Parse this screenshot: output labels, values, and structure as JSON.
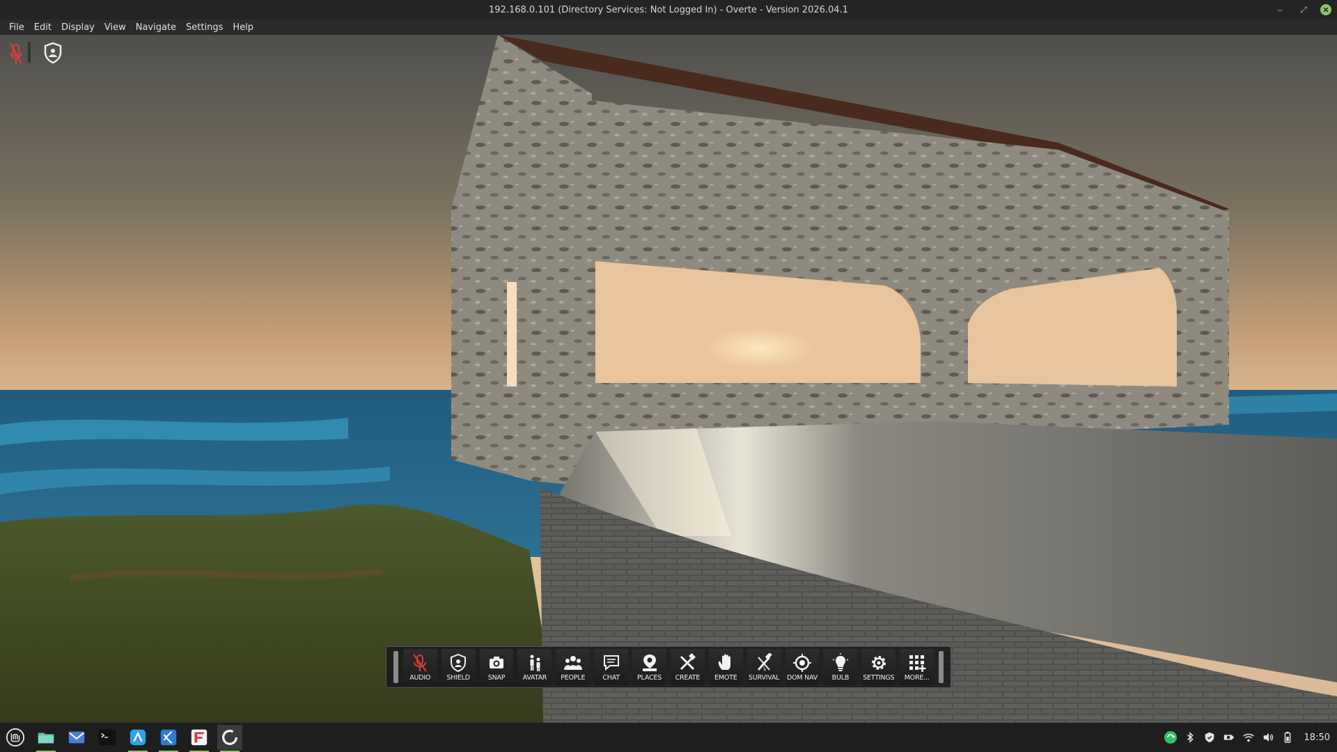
{
  "window": {
    "title": "192.168.0.101 (Directory Services: Not Logged In) - Overte - Version 2026.04.1"
  },
  "menu": [
    "File",
    "Edit",
    "Display",
    "View",
    "Navigate",
    "Settings",
    "Help"
  ],
  "toolbar": {
    "buttons": [
      {
        "label": "AUDIO",
        "icon": "mic-muted-icon"
      },
      {
        "label": "SHIELD",
        "icon": "shield-icon"
      },
      {
        "label": "SNAP",
        "icon": "camera-icon"
      },
      {
        "label": "AVATAR",
        "icon": "avatar-icon"
      },
      {
        "label": "PEOPLE",
        "icon": "people-icon"
      },
      {
        "label": "CHAT",
        "icon": "chat-icon"
      },
      {
        "label": "PLACES",
        "icon": "places-icon"
      },
      {
        "label": "CREATE",
        "icon": "create-icon"
      },
      {
        "label": "EMOTE",
        "icon": "hand-icon"
      },
      {
        "label": "SURVIVAL",
        "icon": "survival-icon"
      },
      {
        "label": "DOM NAV",
        "icon": "crosshair-icon"
      },
      {
        "label": "BULB",
        "icon": "bulb-icon"
      },
      {
        "label": "SETTINGS",
        "icon": "gear-icon"
      },
      {
        "label": "MORE...",
        "icon": "apps-grid-icon"
      }
    ]
  },
  "taskbar": {
    "apps": [
      "mint-menu-icon",
      "folder-icon",
      "mail-icon",
      "terminal-icon",
      "browser-icon",
      "vscode-icon",
      "app-icon",
      "overte-icon"
    ],
    "clock": "18:50"
  },
  "colors": {
    "accent": "#8fc46a",
    "muted_red": "#e23b3b"
  }
}
